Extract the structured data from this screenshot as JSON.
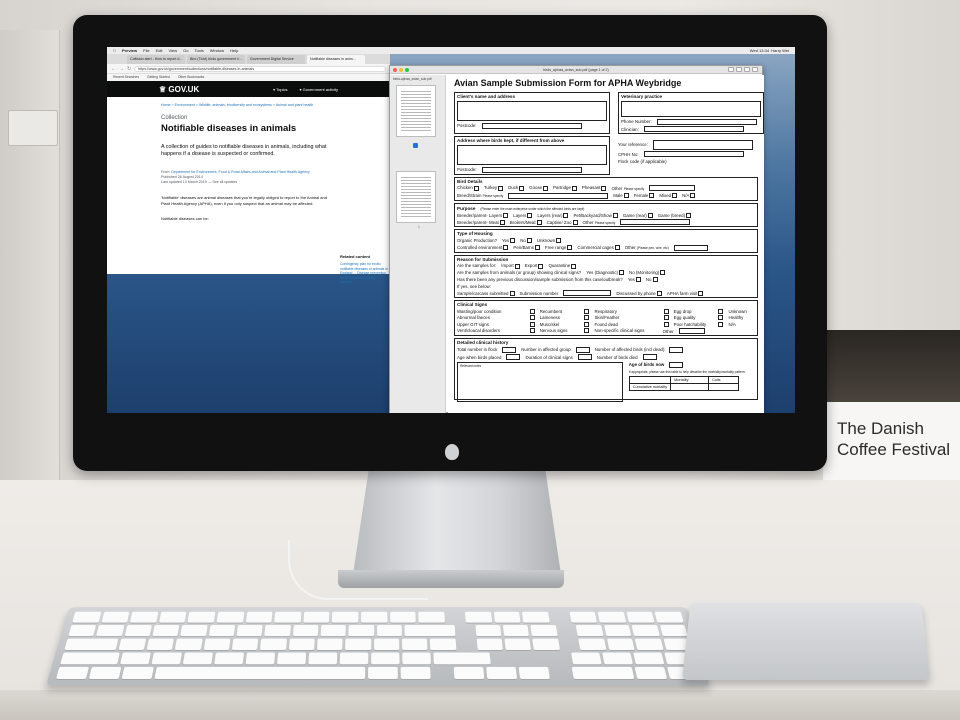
{
  "banner": {
    "line1": "The Danish",
    "line2": "Coffee Festival"
  },
  "menubar": {
    "app": "Preview",
    "items": [
      "File",
      "Edit",
      "View",
      "Go",
      "Tools",
      "Window",
      "Help"
    ],
    "clock": "Wed 13:34",
    "user": "Harry Wei"
  },
  "browser": {
    "tabs": [
      "Collision alert - How to report d...",
      "Bird (Tickt) birds government ri...",
      "Government Digital Service",
      "Notifiable diseases in anim..."
    ],
    "url": "https://www.gov.uk/government/collections/notifiable-diseases-in-animals",
    "bookmarks": [
      "Recent Searches",
      "Getting Started",
      "Other Bookmarks"
    ],
    "gov": {
      "logo": "GOV.UK",
      "topics": "Topics",
      "govt": "Government activity"
    },
    "breadcrumb": "Home  >  Environment  >  Wildlife, animals, biodiversity and ecosystems  >  Animal and plant health",
    "kicker": "Collection",
    "title": "Notifiable diseases in animals",
    "lede": "A collection of guides to notifiable diseases in animals, including what happens if a disease is suspected or confirmed.",
    "from": "From:",
    "from_org": "Department for Environment, Food & Rural Affairs and Animal and Plant Health Agency",
    "published": "Published 26 August 2014",
    "updated": "Last updated 14 March 2019 — See all updates",
    "body1": "'Notifiable' diseases are animal diseases that you're legally obliged to report to the Animal and Plant Health Agency (APHA), even if you only suspect that an animal may be affected.",
    "body2": "Notifiable diseases can be:",
    "related_title": "Related content",
    "related_links": "Contingency plan for exotic notifiable diseases of animals in England ... Disease prevention for livestock and poultry keepers"
  },
  "pdf": {
    "window_title": "birds_aphaa_avian_sub.pdf (page 1 of 2)",
    "file_name": "birds-aphaa_avian_sub.pdf",
    "page_label": "1",
    "heading": "Avian Sample Submission Form for APHA Weybridge",
    "client_title": "Client's name and address",
    "vet_title": "Veterinary practice",
    "postcode": "Postcode:",
    "phone": "Phone Number:",
    "clinician": "Clinician:",
    "birds_kept": "Address where birds kept, if different from above",
    "your_ref": "Your reference:",
    "cph": "CPHH No:",
    "flock": "Flock code (if applicable)",
    "bird_details": "Bird Details",
    "species": [
      "Chicken",
      "Turkey",
      "Duck",
      "Goose",
      "Partridge",
      "Pheasant",
      "Other"
    ],
    "other_specify": "Please specify",
    "breed": "Breed/Strain",
    "sex": [
      "Male",
      "Female",
      "Mixed",
      "N/A"
    ],
    "purpose_title": "Purpose",
    "purpose_note": "(Please enter the main enterprise under which the affected birds are kept)",
    "purpose1": [
      "Breeder/parent- Layers",
      "Layers",
      "Layers (rear)",
      "Pet/Backyard/Show",
      "Game (rear)",
      "Game (breed)"
    ],
    "purpose2": [
      "Breeder/parent- Meat",
      "Broilers/Meat",
      "Captive/ Zoo",
      "Other"
    ],
    "housing_title": "Type of Housing",
    "organic": "Organic Production?",
    "yes": "Yes",
    "no": "No",
    "unknown": "Unknown",
    "housing": [
      "Controlled environment",
      "Pen/Barns",
      "Free range",
      "Commercial cages",
      "Other"
    ],
    "housing_other_note": "(Please pen, wire, etc)",
    "reason_title": "Reason for Submission",
    "reason_q": "Are the samples for:",
    "reason_opts": [
      "Import",
      "Export",
      "Quarantine"
    ],
    "reason_q2": "Are the samples from animals (or group) showing clinical signs?",
    "reason_q2_opts": [
      "Yes (Diagnostic)",
      "No (Monitoring)"
    ],
    "reason_q3": "Has there been any previous discussion/sample submission from this case/outbreak?",
    "reason_q4": "If yes, see below:",
    "reason_row": [
      "Sample/carcass submitted",
      "Submission number",
      "Discussed by phone",
      "APHA farm visit"
    ],
    "clinical_title": "Clinical Signs",
    "clinical_col1": [
      "Wasting/poor condition",
      "Abnormal faeces",
      "Upper GIT signs",
      "Vent/cloacal disorders"
    ],
    "clinical_col2": [
      "Recumbent",
      "Lameness",
      "Musc/skel",
      "Nervous signs"
    ],
    "clinical_col3": [
      "Respiratory",
      "Skin/Feather",
      "Found dead",
      "Non-specific clinical signs"
    ],
    "clinical_col4": [
      "Egg drop",
      "Egg quality",
      "Poor hatchability",
      "Other"
    ],
    "clinical_col5": [
      "Unknown",
      "Healthy",
      "N/A"
    ],
    "history_title": "Detailed clinical history",
    "hist": [
      "Total number in flock",
      "Number in affected group",
      "Number of affected birds (incl dead)",
      "Age when birds placed",
      "Duration of clinical signs",
      "Number of birds died"
    ],
    "notes_label": "Relevant notes",
    "age_title": "Age of birds now",
    "table_note": "If appropriate, please use this table to help describe the morbidity/mortality pattern:",
    "tbl_head": [
      "",
      "Mortality",
      "Culls"
    ],
    "tbl_row": "Cumulative mortality"
  }
}
